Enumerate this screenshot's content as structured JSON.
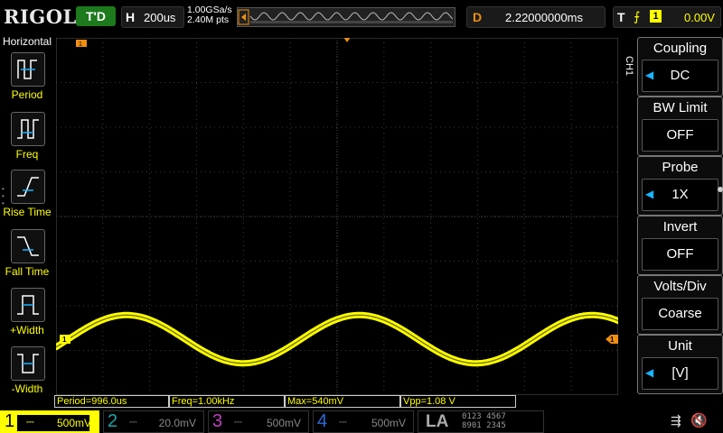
{
  "header": {
    "brand": "RIGOL",
    "run_state": "T'D",
    "horizontal": {
      "label": "H",
      "value": "200us"
    },
    "sample_rate": "1.00GSa/s",
    "memory_depth": "2.40M pts",
    "delay": {
      "label": "D",
      "value": "2.22000000ms"
    },
    "trigger": {
      "label": "T",
      "source": "1",
      "level": "0.00V"
    }
  },
  "left_menu": {
    "title": "Horizontal",
    "items": [
      {
        "label": "Period",
        "icon": "period-icon"
      },
      {
        "label": "Freq",
        "icon": "freq-icon"
      },
      {
        "label": "Rise Time",
        "icon": "rise-time-icon"
      },
      {
        "label": "Fall Time",
        "icon": "fall-time-icon"
      },
      {
        "label": "+Width",
        "icon": "positive-width-icon"
      },
      {
        "label": "-Width",
        "icon": "negative-width-icon"
      }
    ]
  },
  "right_menu": {
    "channel": "CH1",
    "items": [
      {
        "label": "Coupling",
        "value": "DC",
        "has_knob": true
      },
      {
        "label": "BW Limit",
        "value": "OFF",
        "has_knob": false
      },
      {
        "label": "Probe",
        "value": "1X",
        "has_knob": true
      },
      {
        "label": "Invert",
        "value": "OFF",
        "has_knob": false
      },
      {
        "label": "Volts/Div",
        "value": "Coarse",
        "has_knob": false
      },
      {
        "label": "Unit",
        "value": "[V]",
        "has_knob": true
      }
    ]
  },
  "screen": {
    "ch1_marker": "1",
    "trigger_marker": "1",
    "grid_divisions": {
      "horizontal": 12,
      "vertical": 8
    },
    "waveform": {
      "type": "sine",
      "color": "#ffff00",
      "period_divisions": 4.97,
      "amplitude_divisions": 1.08
    }
  },
  "measurements": [
    {
      "text": "Period=996.0us"
    },
    {
      "text": "Freq=1.00kHz"
    },
    {
      "text": "Max=540mV"
    },
    {
      "text": "Vpp=1.08 V"
    }
  ],
  "channels": [
    {
      "num": "1",
      "scale": "500mV",
      "color": "#ffff00",
      "active": true
    },
    {
      "num": "2",
      "scale": "20.0mV",
      "color": "#1aa7a7",
      "active": false
    },
    {
      "num": "3",
      "scale": "500mV",
      "color": "#c040c0",
      "active": false
    },
    {
      "num": "4",
      "scale": "500mV",
      "color": "#2c6cd8",
      "active": false
    }
  ],
  "la": {
    "label": "LA",
    "row1": "0123 4567",
    "row2": "8901 2345"
  },
  "colors": {
    "accent_orange": "#f09010",
    "ch1": "#ffff00",
    "knob_arrow": "#19b4ff"
  }
}
